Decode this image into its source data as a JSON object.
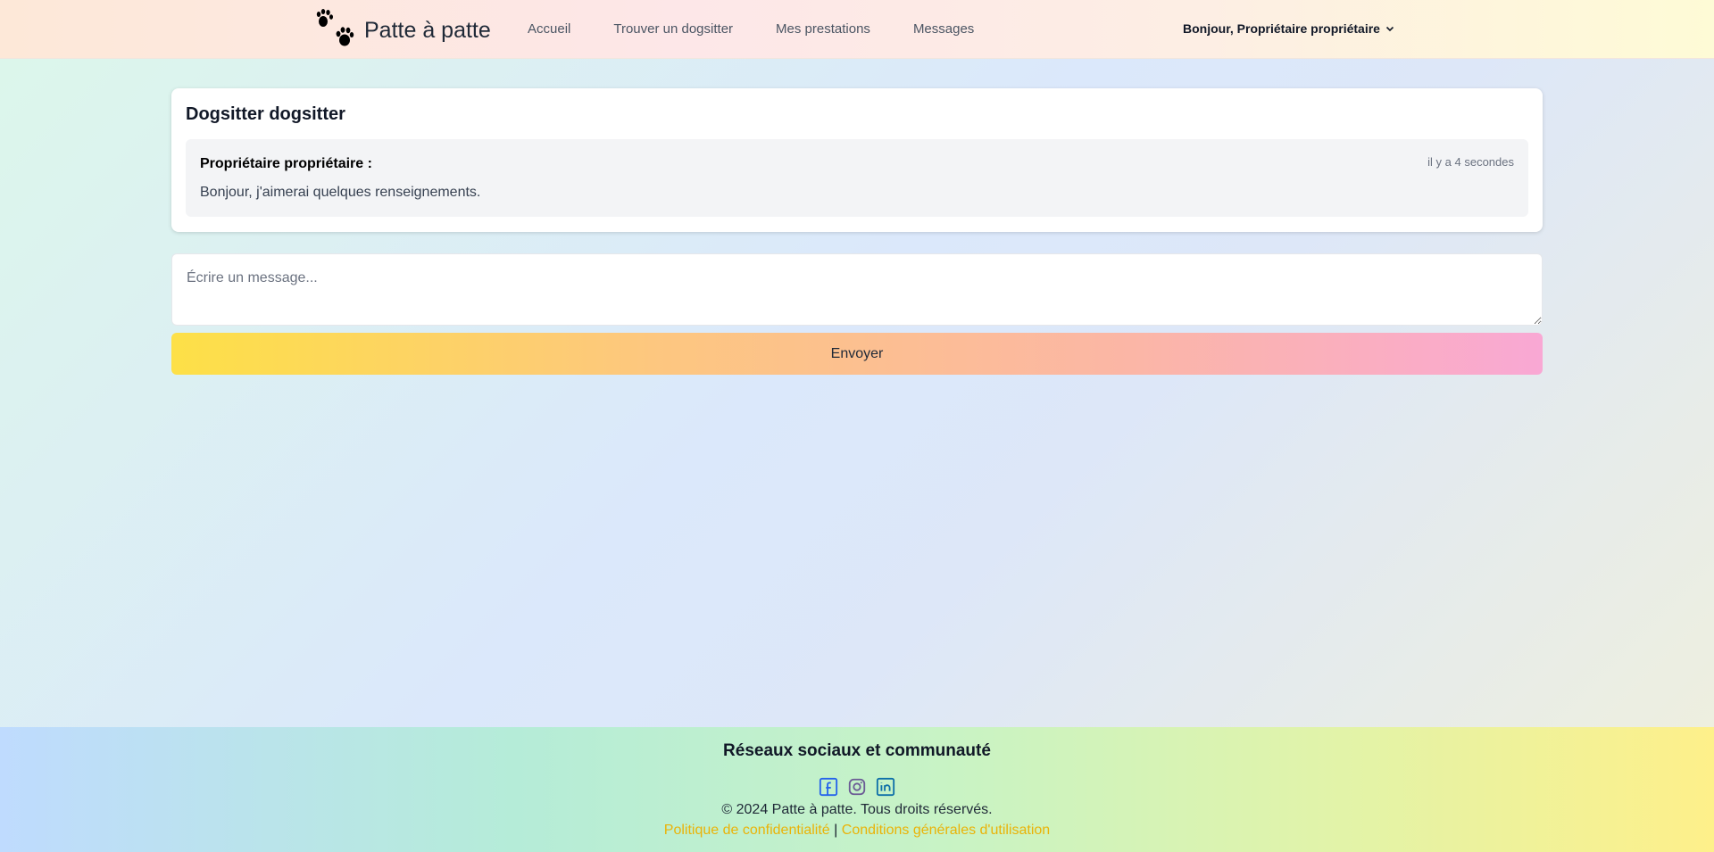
{
  "navbar": {
    "brand": "Patte à patte",
    "logo_icon": "paw-prints-icon",
    "links": [
      "Accueil",
      "Trouver un dogsitter",
      "Mes prestations",
      "Messages"
    ],
    "user_greeting": "Bonjour, Propriétaire propriétaire",
    "user_menu_icon": "chevron-down-icon"
  },
  "conversation": {
    "title": "Dogsitter dogsitter",
    "messages": [
      {
        "author": "Propriétaire propriétaire :",
        "time": "il y a 4 secondes",
        "text": "Bonjour, j'aimerai quelques renseignements."
      }
    ]
  },
  "composer": {
    "placeholder": "Écrire un message...",
    "value": "",
    "send_label": "Envoyer"
  },
  "footer": {
    "title": "Réseaux sociaux et communauté",
    "socials": [
      "facebook-icon",
      "instagram-icon",
      "linkedin-icon"
    ],
    "copyright": "© 2024 Patte à patte. Tous droits réservés.",
    "privacy": "Politique de confidentialité",
    "separator": "|",
    "terms": "Conditions générales d'utilisation"
  },
  "colors": {
    "link_accent": "#eab308",
    "send_gradient_start": "#fde047",
    "send_gradient_end": "#f9a8d4"
  }
}
